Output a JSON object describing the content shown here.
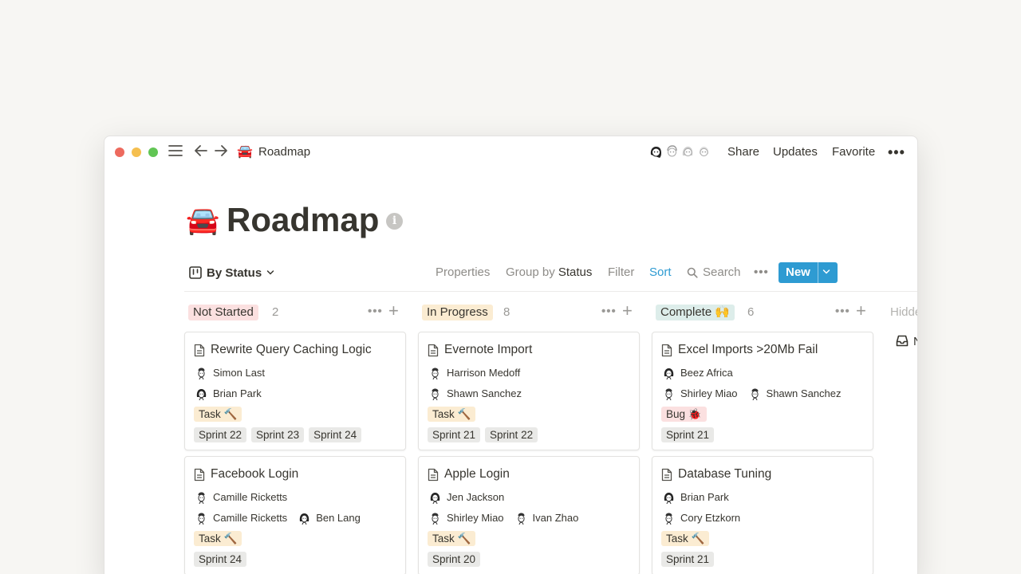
{
  "window": {
    "traffic_lights": {
      "close": "#ed6a5e",
      "minimize": "#f5bf4f",
      "zoom": "#61c554"
    },
    "breadcrumb": {
      "emoji": "🚘",
      "title": "Roadmap"
    },
    "actions": {
      "share": "Share",
      "updates": "Updates",
      "favorite": "Favorite",
      "more": "•••"
    }
  },
  "page": {
    "emoji": "🚘",
    "title": "Roadmap",
    "info": "i"
  },
  "toolbar": {
    "view_label": "By Status",
    "properties": "Properties",
    "group_by_prefix": "Group by",
    "group_by_value": "Status",
    "filter": "Filter",
    "sort": "Sort",
    "search": "Search",
    "more": "•••",
    "new_label": "New"
  },
  "colors": {
    "accent": "#2e9bd2",
    "not_started": "#fbe0e0",
    "in_progress": "#fbecd2",
    "complete": "#ddedea"
  },
  "columns": [
    {
      "status": "Not Started",
      "count": "2",
      "color": "#fbe0e0",
      "cards": [
        {
          "title": "Rewrite Query Caching Logic",
          "people": [
            [
              "Simon Last"
            ],
            [
              "Brian Park"
            ]
          ],
          "type": "Task 🔨",
          "type_kind": "task",
          "sprints": [
            "Sprint 22",
            "Sprint 23",
            "Sprint 24"
          ]
        },
        {
          "title": "Facebook Login",
          "people": [
            [
              "Camille Ricketts"
            ],
            [
              "Camille Ricketts",
              "Ben Lang"
            ]
          ],
          "type": "Task 🔨",
          "type_kind": "task",
          "sprints": [
            "Sprint 24"
          ]
        }
      ]
    },
    {
      "status": "In Progress",
      "count": "8",
      "color": "#fbecd2",
      "cards": [
        {
          "title": "Evernote Import",
          "people": [
            [
              "Harrison Medoff"
            ],
            [
              "Shawn Sanchez"
            ]
          ],
          "type": "Task 🔨",
          "type_kind": "task",
          "sprints": [
            "Sprint 21",
            "Sprint 22"
          ]
        },
        {
          "title": "Apple Login",
          "people": [
            [
              "Jen Jackson"
            ],
            [
              "Shirley Miao",
              "Ivan Zhao"
            ]
          ],
          "type": "Task 🔨",
          "type_kind": "task",
          "sprints": [
            "Sprint 20"
          ]
        }
      ]
    },
    {
      "status": "Complete 🙌",
      "count": "6",
      "color": "#ddedea",
      "cards": [
        {
          "title": "Excel Imports >20Mb Fail",
          "people": [
            [
              "Beez Africa"
            ],
            [
              "Shirley Miao",
              "Shawn Sanchez"
            ]
          ],
          "type": "Bug 🐞",
          "type_kind": "bug",
          "sprints": [
            "Sprint 21"
          ]
        },
        {
          "title": "Database Tuning",
          "people": [
            [
              "Brian Park"
            ],
            [
              "Cory Etzkorn"
            ]
          ],
          "type": "Task 🔨",
          "type_kind": "task",
          "sprints": [
            "Sprint 21"
          ]
        }
      ]
    }
  ],
  "hidden_column": {
    "label": "Hidden",
    "item": "N"
  }
}
